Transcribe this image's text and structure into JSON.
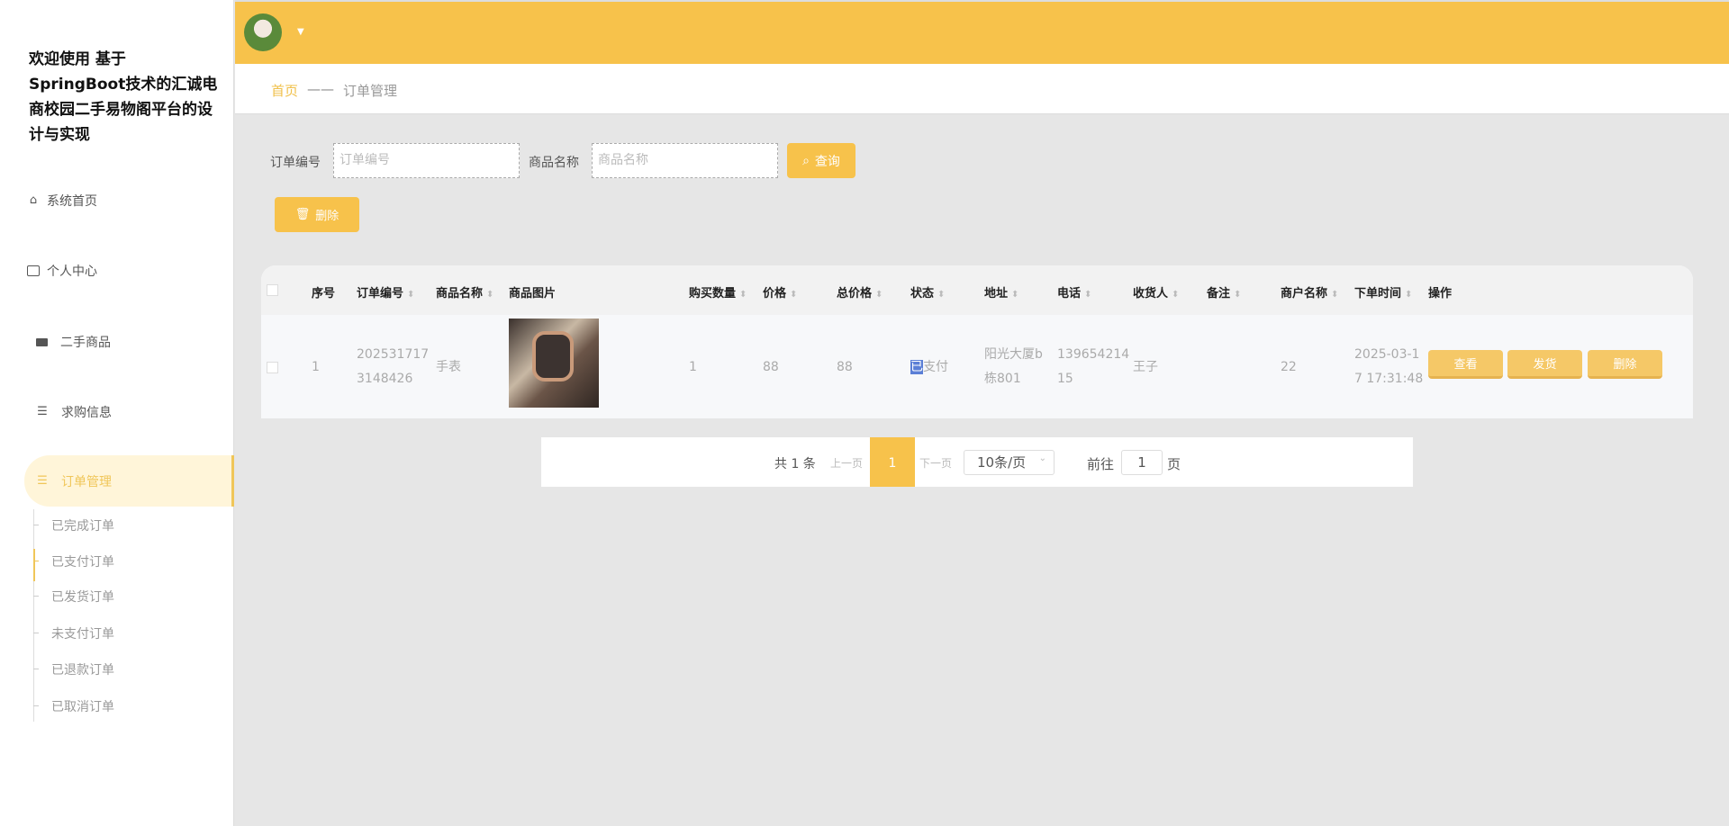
{
  "sidebar": {
    "title": "欢迎使用 基于SpringBoot技术的汇诚电商校园二手易物阁平台的设计与实现",
    "items": [
      {
        "label": "系统首页",
        "icon": "home-icon"
      },
      {
        "label": "个人中心",
        "icon": "wallet-icon"
      },
      {
        "label": "二手商品",
        "icon": "briefcase-icon"
      },
      {
        "label": "求购信息",
        "icon": "list-icon"
      },
      {
        "label": "订单管理",
        "icon": "list-icon",
        "active": true
      }
    ],
    "sub_items": [
      "已完成订单",
      "已支付订单",
      "已发货订单",
      "未支付订单",
      "已退款订单",
      "已取消订单"
    ],
    "active_sub": "已支付订单"
  },
  "header": {
    "avatar": "user-avatar"
  },
  "breadcrumb": {
    "home": "首页",
    "sep": "——",
    "current": "订单管理"
  },
  "search": {
    "order_no_label": "订单编号",
    "order_no_placeholder": "订单编号",
    "product_label": "商品名称",
    "product_placeholder": "商品名称",
    "query_label": "查询",
    "delete_label": "删除"
  },
  "table": {
    "headers": [
      "序号",
      "订单编号",
      "商品名称",
      "商品图片",
      "购买数量",
      "价格",
      "总价格",
      "状态",
      "地址",
      "电话",
      "收货人",
      "备注",
      "商户名称",
      "下单时间",
      "操作"
    ],
    "rows": [
      {
        "index": "1",
        "order_no_1": "202531717",
        "order_no_2": "3148426",
        "product": "手表",
        "image": "watch-photo",
        "qty": "1",
        "price": "88",
        "total": "88",
        "status_hl": "已",
        "status_rest": "支付",
        "addr_1": "阳光大厦b",
        "addr_2": "栋801",
        "phone_1": "139654214",
        "phone_2": "15",
        "receiver": "王子",
        "note": "",
        "merchant": "22",
        "time_1": "2025-03-1",
        "time_2": "7 17:31:48",
        "actions": [
          "查看",
          "发货",
          "删除"
        ]
      }
    ]
  },
  "pagination": {
    "total": "共 1 条",
    "prev": "上一页",
    "page": "1",
    "next": "下一页",
    "size": "10条/页",
    "goto": "前往",
    "goto_value": "1",
    "page_unit": "页"
  },
  "colors": {
    "accent": "#f7c24b",
    "active_bg": "#fff5d9",
    "status_highlight": "#5b7fd6"
  }
}
